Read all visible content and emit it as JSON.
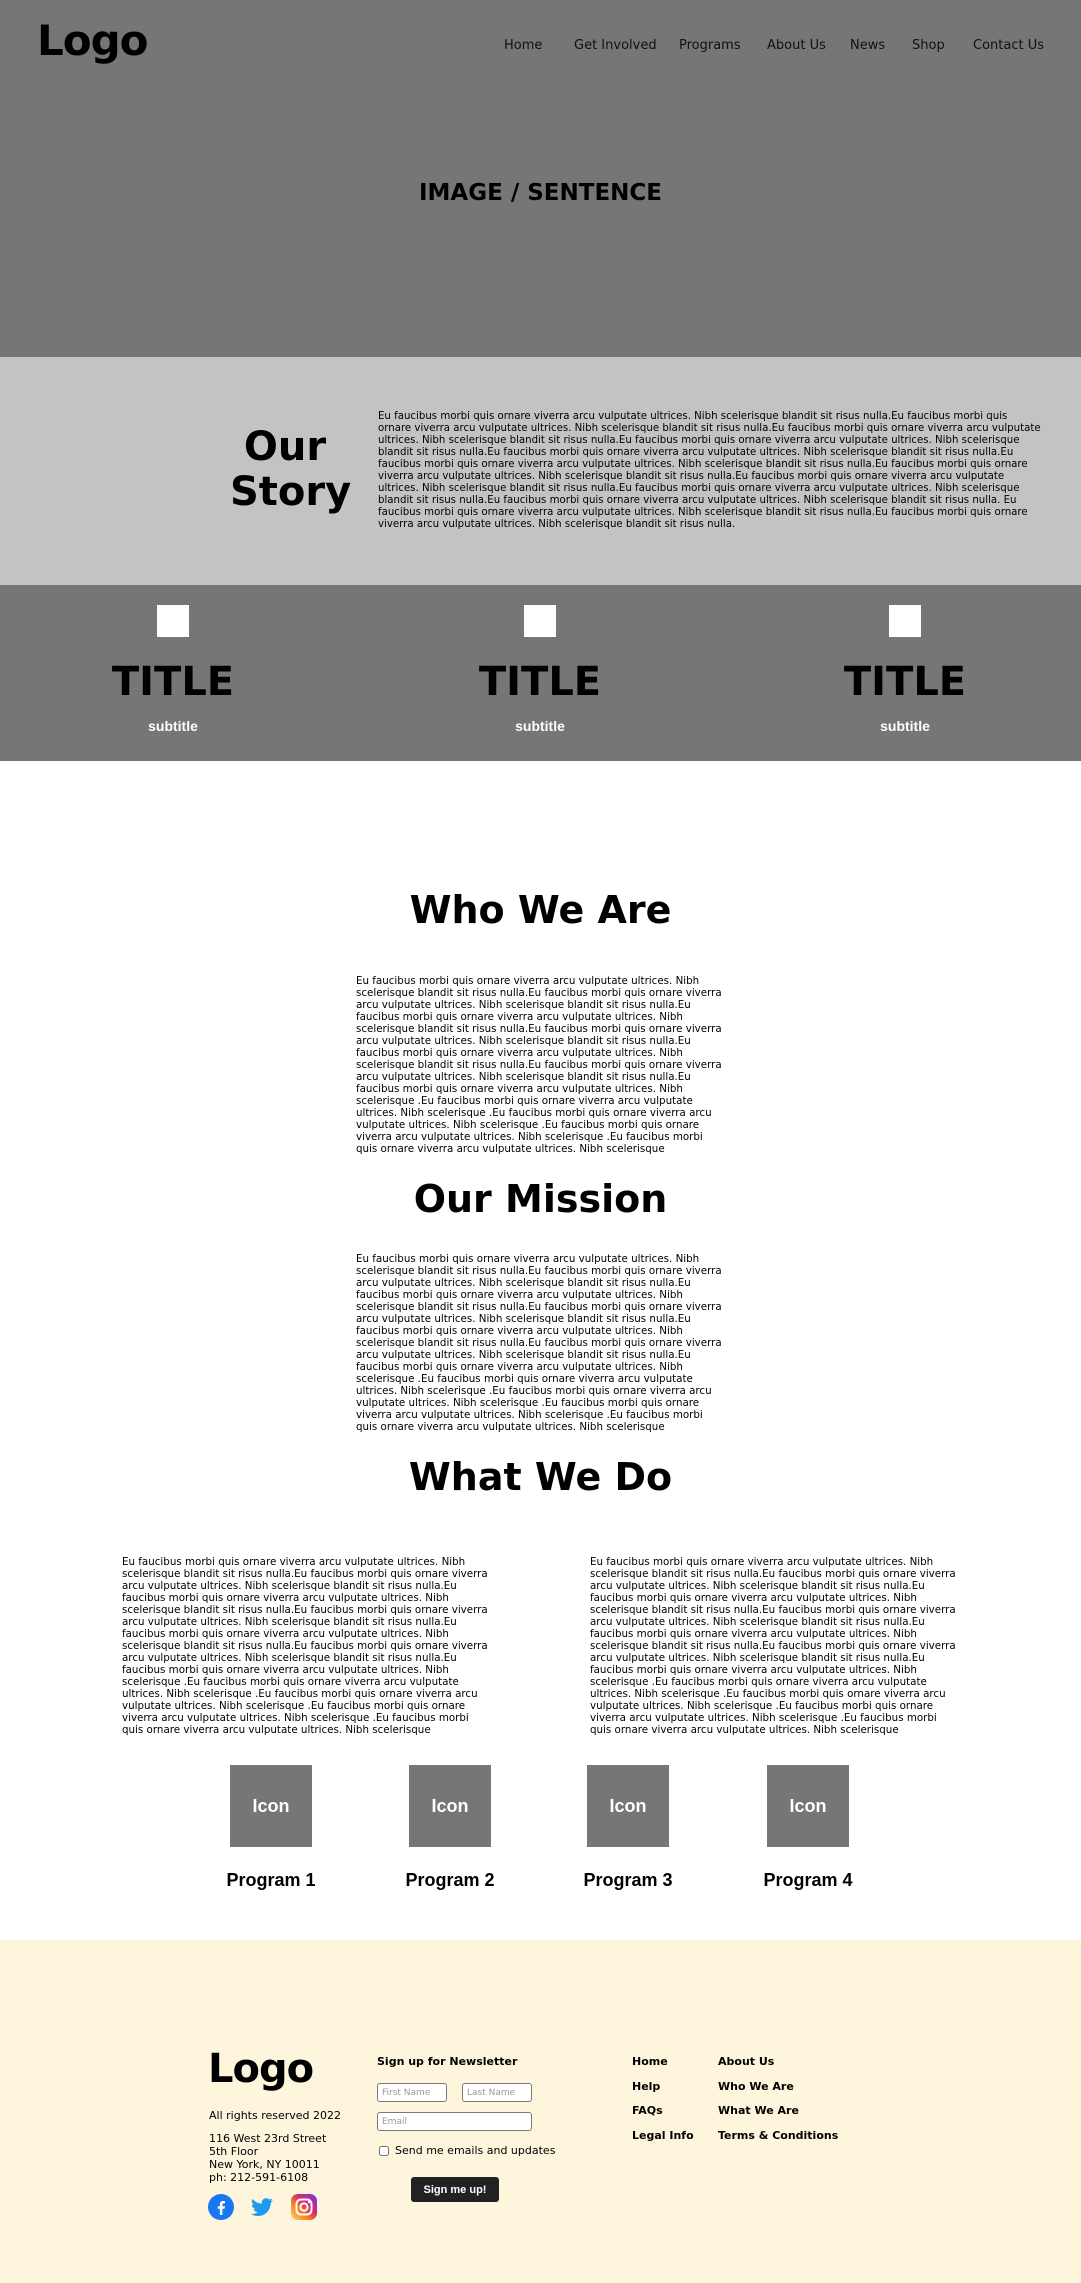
{
  "header": {
    "logo": "Logo",
    "nav": [
      "Home",
      "Get Involved",
      "Programs",
      "About Us",
      "News",
      "Shop",
      "Contact Us"
    ]
  },
  "hero": {
    "text": "IMAGE / SENTENCE"
  },
  "story": {
    "title": "Our Story",
    "text": "Eu faucibus morbi quis ornare viverra arcu vulputate ultrices. Nibh scelerisque blandit sit risus nulla.Eu faucibus morbi quis ornare viverra arcu vulputate ultrices. Nibh scelerisque blandit sit risus nulla.Eu faucibus morbi quis ornare viverra arcu vulputate ultrices. Nibh scelerisque blandit sit risus nulla.Eu faucibus morbi quis ornare viverra arcu vulputate ultrices. Nibh scelerisque blandit sit risus nulla.Eu faucibus morbi quis ornare viverra arcu vulputate ultrices. Nibh scelerisque blandit sit risus nulla.Eu faucibus morbi quis ornare viverra arcu vulputate ultrices. Nibh scelerisque blandit sit risus nulla.Eu faucibus morbi quis ornare viverra arcu vulputate ultrices. Nibh scelerisque blandit sit risus nulla.Eu faucibus morbi quis ornare viverra arcu vulputate ultrices. Nibh scelerisque blandit sit risus nulla.Eu faucibus morbi quis ornare viverra arcu vulputate ultrices. Nibh scelerisque blandit sit risus nulla.Eu faucibus morbi quis ornare viverra arcu vulputate ultrices. Nibh scelerisque blandit sit risus nulla. Eu faucibus morbi quis ornare viverra arcu vulputate ultrices. Nibh scelerisque blandit sit risus nulla.Eu faucibus morbi quis ornare viverra arcu vulputate ultrices. Nibh scelerisque blandit sit risus nulla."
  },
  "features": [
    {
      "title": "TITLE",
      "subtitle": "subtitle"
    },
    {
      "title": "TITLE",
      "subtitle": "subtitle"
    },
    {
      "title": "TITLE",
      "subtitle": "subtitle"
    }
  ],
  "who_we_are": {
    "title": "Who We Are",
    "text": "Eu faucibus morbi quis ornare viverra arcu vulputate ultrices. Nibh scelerisque blandit sit risus nulla.Eu faucibus morbi quis ornare viverra arcu vulputate ultrices. Nibh scelerisque blandit sit risus nulla.Eu faucibus morbi quis ornare viverra arcu vulputate ultrices. Nibh scelerisque blandit sit risus nulla.Eu faucibus morbi quis ornare viverra arcu vulputate ultrices. Nibh scelerisque blandit sit risus nulla.Eu faucibus morbi quis ornare viverra arcu vulputate ultrices. Nibh scelerisque blandit sit risus nulla.Eu faucibus morbi quis ornare viverra arcu vulputate ultrices. Nibh scelerisque blandit sit risus nulla.Eu faucibus morbi quis ornare viverra arcu vulputate ultrices. Nibh scelerisque .Eu faucibus morbi quis ornare viverra arcu vulputate ultrices. Nibh scelerisque .Eu faucibus morbi quis ornare viverra arcu vulputate ultrices. Nibh scelerisque .Eu faucibus morbi quis ornare viverra arcu vulputate ultrices. Nibh scelerisque .Eu faucibus morbi quis ornare viverra arcu vulputate ultrices. Nibh scelerisque"
  },
  "our_mission": {
    "title": "Our Mission",
    "text": "Eu faucibus morbi quis ornare viverra arcu vulputate ultrices. Nibh scelerisque blandit sit risus nulla.Eu faucibus morbi quis ornare viverra arcu vulputate ultrices. Nibh scelerisque blandit sit risus nulla.Eu faucibus morbi quis ornare viverra arcu vulputate ultrices. Nibh scelerisque blandit sit risus nulla.Eu faucibus morbi quis ornare viverra arcu vulputate ultrices. Nibh scelerisque blandit sit risus nulla.Eu faucibus morbi quis ornare viverra arcu vulputate ultrices. Nibh scelerisque blandit sit risus nulla.Eu faucibus morbi quis ornare viverra arcu vulputate ultrices. Nibh scelerisque blandit sit risus nulla.Eu faucibus morbi quis ornare viverra arcu vulputate ultrices. Nibh scelerisque .Eu faucibus morbi quis ornare viverra arcu vulputate ultrices. Nibh scelerisque .Eu faucibus morbi quis ornare viverra arcu vulputate ultrices. Nibh scelerisque .Eu faucibus morbi quis ornare viverra arcu vulputate ultrices. Nibh scelerisque .Eu faucibus morbi quis ornare viverra arcu vulputate ultrices. Nibh scelerisque"
  },
  "what_we_do": {
    "title": "What We Do",
    "left_text": "Eu faucibus morbi quis ornare viverra arcu vulputate ultrices. Nibh scelerisque blandit sit risus nulla.Eu faucibus morbi quis ornare viverra arcu vulputate ultrices. Nibh scelerisque blandit sit risus nulla.Eu faucibus morbi quis ornare viverra arcu vulputate ultrices. Nibh scelerisque blandit sit risus nulla.Eu faucibus morbi quis ornare viverra arcu vulputate ultrices. Nibh scelerisque blandit sit risus nulla.Eu faucibus morbi quis ornare viverra arcu vulputate ultrices. Nibh scelerisque blandit sit risus nulla.Eu faucibus morbi quis ornare viverra arcu vulputate ultrices. Nibh scelerisque blandit sit risus nulla.Eu faucibus morbi quis ornare viverra arcu vulputate ultrices. Nibh scelerisque .Eu faucibus morbi quis ornare viverra arcu vulputate ultrices. Nibh scelerisque .Eu faucibus morbi quis ornare viverra arcu vulputate ultrices. Nibh scelerisque .Eu faucibus morbi quis ornare viverra arcu vulputate ultrices. Nibh scelerisque .Eu faucibus morbi quis ornare viverra arcu vulputate ultrices. Nibh scelerisque",
    "right_text": "Eu faucibus morbi quis ornare viverra arcu vulputate ultrices. Nibh scelerisque blandit sit risus nulla.Eu faucibus morbi quis ornare viverra arcu vulputate ultrices. Nibh scelerisque blandit sit risus nulla.Eu faucibus morbi quis ornare viverra arcu vulputate ultrices. Nibh scelerisque blandit sit risus nulla.Eu faucibus morbi quis ornare viverra arcu vulputate ultrices. Nibh scelerisque blandit sit risus nulla.Eu faucibus morbi quis ornare viverra arcu vulputate ultrices. Nibh scelerisque blandit sit risus nulla.Eu faucibus morbi quis ornare viverra arcu vulputate ultrices. Nibh scelerisque blandit sit risus nulla.Eu faucibus morbi quis ornare viverra arcu vulputate ultrices. Nibh scelerisque .Eu faucibus morbi quis ornare viverra arcu vulputate ultrices. Nibh scelerisque .Eu faucibus morbi quis ornare viverra arcu vulputate ultrices. Nibh scelerisque .Eu faucibus morbi quis ornare viverra arcu vulputate ultrices. Nibh scelerisque .Eu faucibus morbi quis ornare viverra arcu vulputate ultrices. Nibh scelerisque"
  },
  "programs": [
    {
      "icon": "Icon",
      "label": "Program 1"
    },
    {
      "icon": "Icon",
      "label": "Program 2"
    },
    {
      "icon": "Icon",
      "label": "Program 3"
    },
    {
      "icon": "Icon",
      "label": "Program 4"
    }
  ],
  "footer": {
    "logo": "Logo",
    "rights": "All rights reserved 2022",
    "address": [
      "116 West 23rd Street",
      "5th Floor",
      "New York, NY 10011",
      "ph: 212-591-6108"
    ],
    "social": [
      "facebook-icon",
      "twitter-icon",
      "instagram-icon"
    ],
    "newsletter": {
      "title": "Sign up for Newsletter",
      "first_name_placeholder": "First Name",
      "last_name_placeholder": "Last Name",
      "email_placeholder": "Email",
      "checkbox_label": "Send me emails and updates",
      "button": "Sign me up!"
    },
    "links_col1": [
      "Home",
      "Help",
      "FAQs",
      "Legal Info"
    ],
    "links_col2": [
      "About Us",
      "Who We Are",
      "What We Are",
      "Terms & Conditions"
    ]
  },
  "colors": {
    "hero_bg": "#767676",
    "story_bg": "#c3c3c3",
    "footer_bg": "#fdf5dc",
    "button_bg": "#222222"
  }
}
